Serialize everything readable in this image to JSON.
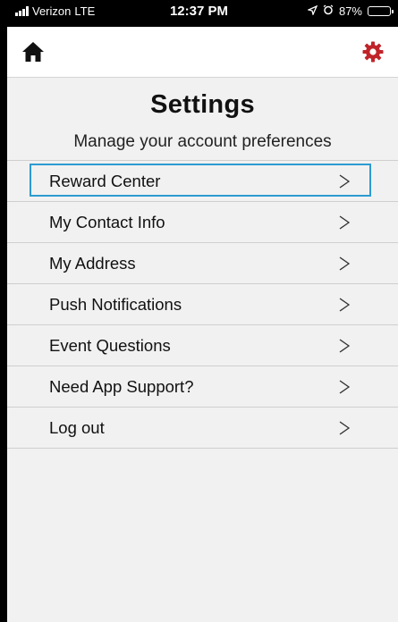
{
  "status_bar": {
    "carrier": "Verizon",
    "network": "LTE",
    "time": "12:37 PM",
    "battery": "87%",
    "battery_level": 0.87
  },
  "nav": {
    "home_icon": "home-icon",
    "settings_icon": "gear-icon",
    "accent_color": "#c0242a"
  },
  "page": {
    "title": "Settings",
    "subtitle": "Manage your account preferences"
  },
  "menu": {
    "items": [
      {
        "label": "Reward Center",
        "selected": true
      },
      {
        "label": "My Contact Info"
      },
      {
        "label": "My Address"
      },
      {
        "label": "Push Notifications"
      },
      {
        "label": "Event Questions"
      },
      {
        "label": "Need App Support?"
      },
      {
        "label": "Log out"
      }
    ]
  },
  "colors": {
    "focus": "#2d9bd2",
    "background": "#f1f1f1"
  }
}
